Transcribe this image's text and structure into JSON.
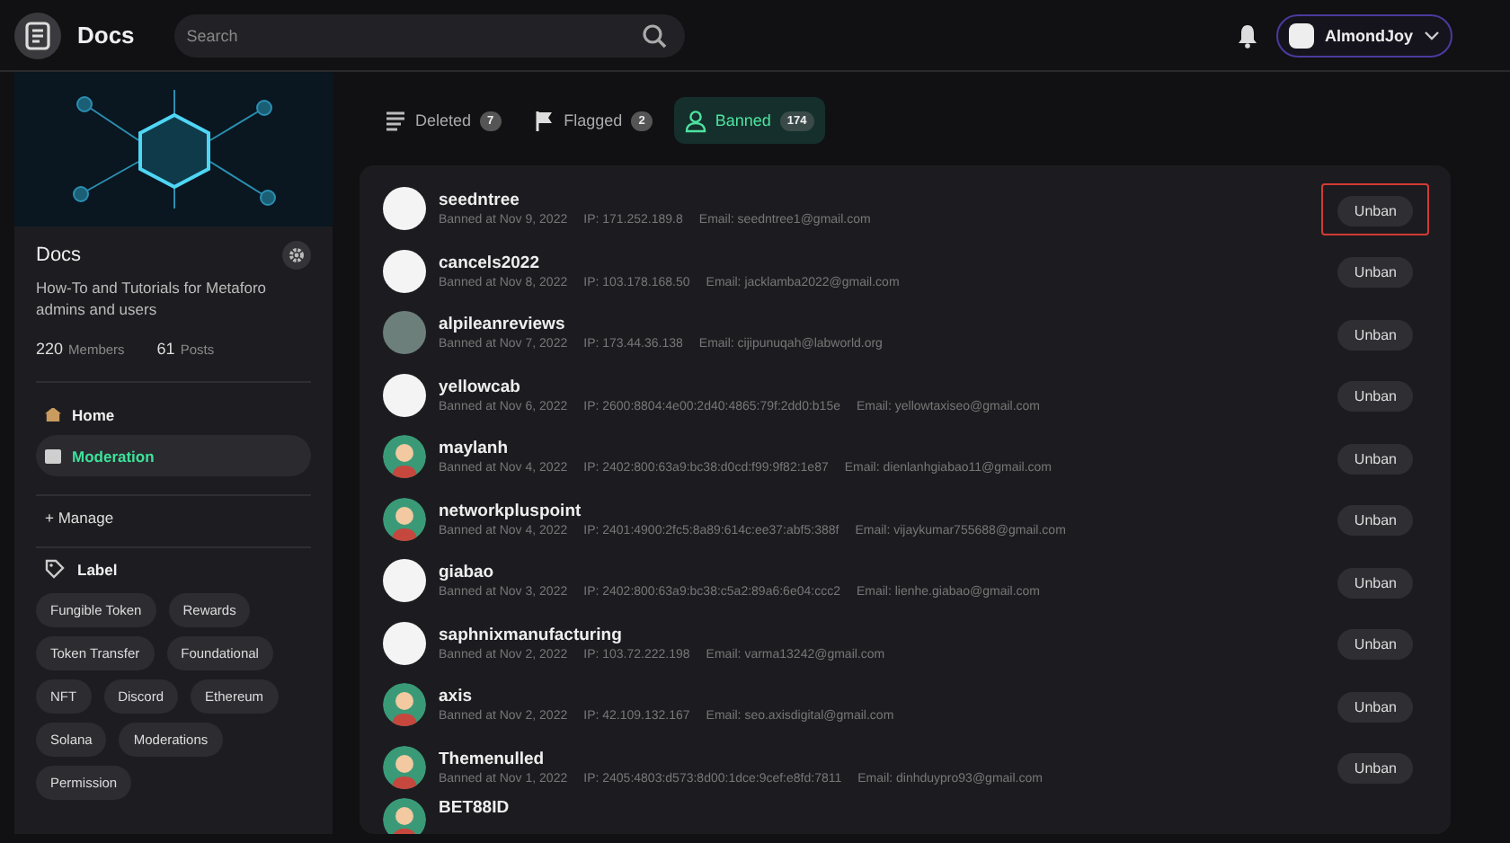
{
  "header": {
    "title": "Docs",
    "search": {
      "placeholder": "Search"
    },
    "user": {
      "name": "AlmondJoy"
    }
  },
  "sidebar": {
    "title": "Docs",
    "description": "How-To and Tutorials for Metaforo admins and users",
    "stats": [
      {
        "value": "220",
        "label": "Members"
      },
      {
        "value": "61",
        "label": "Posts"
      }
    ],
    "nav": [
      {
        "label": "Home",
        "selected": false
      },
      {
        "label": "Moderation",
        "selected": true
      }
    ],
    "manage": "+ Manage",
    "label_heading": "Label",
    "labels": [
      "Fungible Token",
      "Rewards",
      "Token Transfer",
      "Foundational",
      "NFT",
      "Discord",
      "Ethereum",
      "Solana",
      "Moderations",
      "Permission"
    ]
  },
  "tabs": [
    {
      "label": "Deleted",
      "count": "7",
      "selected": false,
      "kind": "list"
    },
    {
      "label": "Flagged",
      "count": "2",
      "selected": false,
      "kind": "flag"
    },
    {
      "label": "Banned",
      "count": "174",
      "selected": true,
      "kind": "user"
    }
  ],
  "banned_users": [
    {
      "name": "seedntree",
      "kind": "logo",
      "banned": "Banned at Nov 9, 2022",
      "ip": "IP: 171.252.189.8",
      "email": "Email: seedntree1@gmail.com",
      "button": "Unban",
      "highlighted": true
    },
    {
      "name": "cancels2022",
      "kind": "logo",
      "banned": "Banned at Nov 8, 2022",
      "ip": "IP: 103.178.168.50",
      "email": "Email: jacklamba2022@gmail.com",
      "button": "Unban",
      "highlighted": false
    },
    {
      "name": "alpileanreviews",
      "kind": "photo",
      "banned": "Banned at Nov 7, 2022",
      "ip": "IP: 173.44.36.138",
      "email": "Email: cijipunuqah@labworld.org",
      "button": "Unban",
      "highlighted": false
    },
    {
      "name": "yellowcab",
      "kind": "logo",
      "banned": "Banned at Nov 6, 2022",
      "ip": "IP: 2600:8804:4e00:2d40:4865:79f:2dd0:b15e",
      "email": "Email: yellowtaxiseo@gmail.com",
      "button": "Unban",
      "highlighted": false
    },
    {
      "name": "maylanh",
      "kind": "person",
      "banned": "Banned at Nov 4, 2022",
      "ip": "IP: 2402:800:63a9:bc38:d0cd:f99:9f82:1e87",
      "email": "Email: dienlanhgiabao11@gmail.com",
      "button": "Unban",
      "highlighted": false
    },
    {
      "name": "networkpluspoint",
      "kind": "person",
      "banned": "Banned at Nov 4, 2022",
      "ip": "IP: 2401:4900:2fc5:8a89:614c:ee37:abf5:388f",
      "email": "Email: vijaykumar755688@gmail.com",
      "button": "Unban",
      "highlighted": false
    },
    {
      "name": "giabao",
      "kind": "logo",
      "banned": "Banned at Nov 3, 2022",
      "ip": "IP: 2402:800:63a9:bc38:c5a2:89a6:6e04:ccc2",
      "email": "Email: lienhe.giabao@gmail.com",
      "button": "Unban",
      "highlighted": false
    },
    {
      "name": "saphnixmanufacturing",
      "kind": "logo",
      "banned": "Banned at Nov 2, 2022",
      "ip": "IP: 103.72.222.198",
      "email": "Email: varma13242@gmail.com",
      "button": "Unban",
      "highlighted": false
    },
    {
      "name": "axis",
      "kind": "person",
      "banned": "Banned at Nov 2, 2022",
      "ip": "IP: 42.109.132.167",
      "email": "Email: seo.axisdigital@gmail.com",
      "button": "Unban",
      "highlighted": false
    },
    {
      "name": "Themenulled",
      "kind": "person",
      "banned": "Banned at Nov 1, 2022",
      "ip": "IP: 2405:4803:d573:8d00:1dce:9cef:e8fd:7811",
      "email": "Email: dinhduypro93@gmail.com",
      "button": "Unban",
      "highlighted": false
    },
    {
      "name": "BET88ID",
      "kind": "person"
    }
  ]
}
